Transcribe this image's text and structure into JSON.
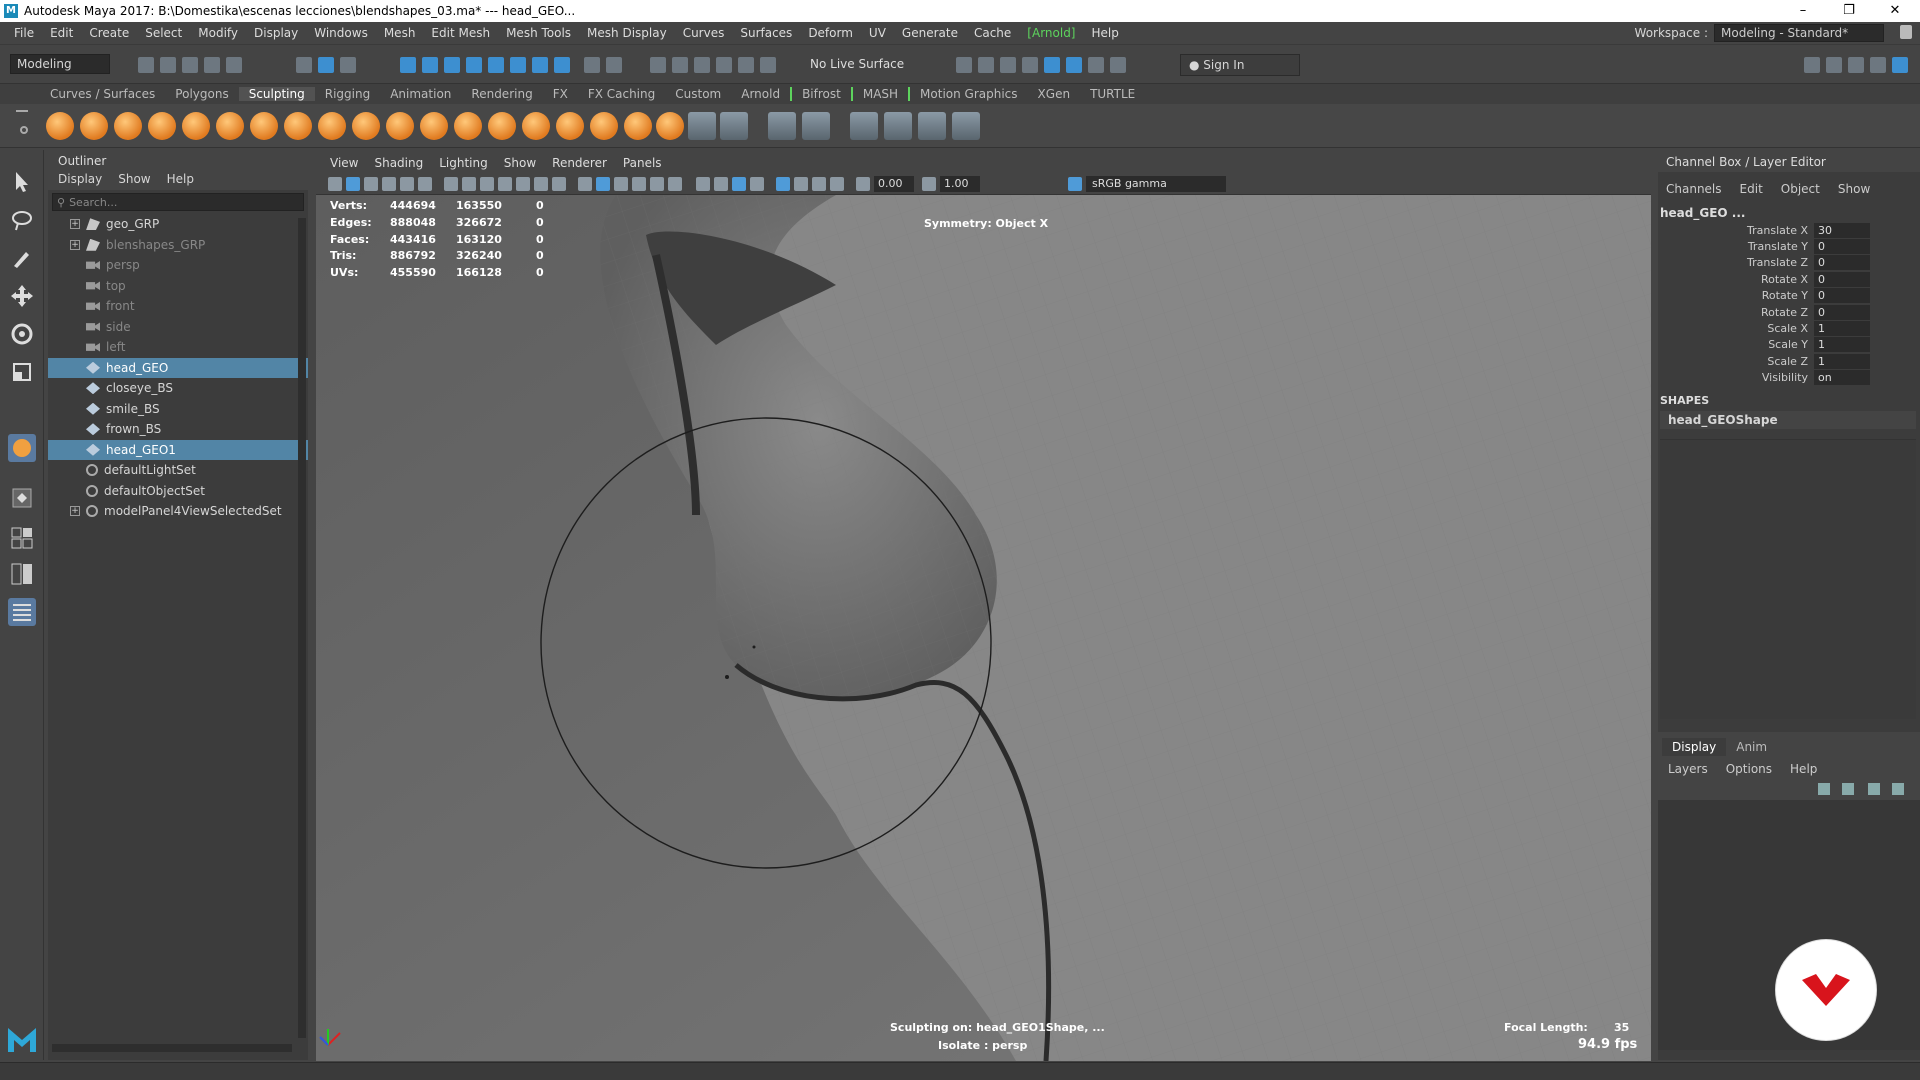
{
  "titlebar": {
    "title": "Autodesk Maya 2017: B:\\Domestika\\escenas lecciones\\blendshapes_03.ma*   ---   head_GEO...",
    "logo_letter": "M"
  },
  "menubar": {
    "items": [
      "File",
      "Edit",
      "Create",
      "Select",
      "Modify",
      "Display",
      "Windows",
      "Mesh",
      "Edit Mesh",
      "Mesh Tools",
      "Mesh Display",
      "Curves",
      "Surfaces",
      "Deform",
      "UV",
      "Generate",
      "Cache",
      "[Arnold]",
      "Help"
    ],
    "workspace_label": "Workspace :",
    "workspace_value": "Modeling - Standard*"
  },
  "statusline": {
    "mode": "Modeling",
    "live_surface": "No Live Surface",
    "sign_in": "Sign In"
  },
  "shelf": {
    "tabs": [
      "Curves / Surfaces",
      "Polygons",
      "Sculpting",
      "Rigging",
      "Animation",
      "Rendering",
      "FX",
      "FX Caching",
      "Custom",
      "Arnold",
      "Bifrost",
      "MASH",
      "Motion Graphics",
      "XGen",
      "TURTLE"
    ],
    "active_tab": "Sculpting"
  },
  "outliner": {
    "title": "Outliner",
    "menu": [
      "Display",
      "Show",
      "Help"
    ],
    "search_placeholder": "Search...",
    "items": [
      {
        "label": "geo_GRP",
        "icon": "group-icon",
        "expand": "+",
        "state": "normal"
      },
      {
        "label": "blenshapes_GRP",
        "icon": "group-icon",
        "expand": "+",
        "state": "dim"
      },
      {
        "label": "persp",
        "icon": "camera-icon",
        "expand": "",
        "state": "dim"
      },
      {
        "label": "top",
        "icon": "camera-icon",
        "expand": "",
        "state": "dim"
      },
      {
        "label": "front",
        "icon": "camera-icon",
        "expand": "",
        "state": "dim"
      },
      {
        "label": "side",
        "icon": "camera-icon",
        "expand": "",
        "state": "dim"
      },
      {
        "label": "left",
        "icon": "camera-icon",
        "expand": "",
        "state": "dim"
      },
      {
        "label": "head_GEO",
        "icon": "mesh-icon",
        "expand": "",
        "state": "selected"
      },
      {
        "label": "closeye_BS",
        "icon": "mesh-icon",
        "expand": "",
        "state": "normal"
      },
      {
        "label": "smile_BS",
        "icon": "mesh-icon",
        "expand": "",
        "state": "normal"
      },
      {
        "label": "frown_BS",
        "icon": "mesh-icon",
        "expand": "",
        "state": "normal"
      },
      {
        "label": "head_GEO1",
        "icon": "mesh-icon",
        "expand": "",
        "state": "selected"
      },
      {
        "label": "defaultLightSet",
        "icon": "set-icon",
        "expand": "",
        "state": "normal"
      },
      {
        "label": "defaultObjectSet",
        "icon": "set-icon",
        "expand": "",
        "state": "normal"
      },
      {
        "label": "modelPanel4ViewSelectedSet",
        "icon": "set-icon",
        "expand": "+",
        "state": "normal"
      }
    ]
  },
  "viewport": {
    "menu": [
      "View",
      "Shading",
      "Lighting",
      "Show",
      "Renderer",
      "Panels"
    ],
    "exposure": "0.00",
    "gamma_value": "1.00",
    "color_space": "sRGB gamma",
    "stats": [
      {
        "label": "Verts:",
        "a": "444694",
        "b": "163550",
        "c": "0"
      },
      {
        "label": "Edges:",
        "a": "888048",
        "b": "326672",
        "c": "0"
      },
      {
        "label": "Faces:",
        "a": "443416",
        "b": "163120",
        "c": "0"
      },
      {
        "label": "Tris:",
        "a": "886792",
        "b": "326240",
        "c": "0"
      },
      {
        "label": "UVs:",
        "a": "455590",
        "b": "166128",
        "c": "0"
      }
    ],
    "symmetry": "Symmetry: Object X",
    "sculpting_on": "Sculpting on: head_GEO1Shape, ...",
    "isolate": "Isolate : persp",
    "focal_label": "Focal Length:",
    "focal_value": "35",
    "fps": "94.9 fps"
  },
  "channelbox": {
    "title": "Channel Box / Layer Editor",
    "menu": [
      "Channels",
      "Edit",
      "Object",
      "Show"
    ],
    "object": "head_GEO ...",
    "channels": [
      {
        "label": "Translate X",
        "value": "30"
      },
      {
        "label": "Translate Y",
        "value": "0"
      },
      {
        "label": "Translate Z",
        "value": "0"
      },
      {
        "label": "Rotate X",
        "value": "0"
      },
      {
        "label": "Rotate Y",
        "value": "0"
      },
      {
        "label": "Rotate Z",
        "value": "0"
      },
      {
        "label": "Scale X",
        "value": "1"
      },
      {
        "label": "Scale Y",
        "value": "1"
      },
      {
        "label": "Scale Z",
        "value": "1"
      },
      {
        "label": "Visibility",
        "value": "on"
      }
    ],
    "shapes_header": "SHAPES",
    "shape_name": "head_GEOShape"
  },
  "layereditor": {
    "tabs": [
      "Display",
      "Anim"
    ],
    "active_tab": "Display",
    "menu": [
      "Layers",
      "Options",
      "Help"
    ]
  },
  "colors": {
    "selection": "#5285a6",
    "accent_blue": "#3d8fd0",
    "arnold_green": "#5dd35d",
    "badge_red": "#d8141c"
  }
}
